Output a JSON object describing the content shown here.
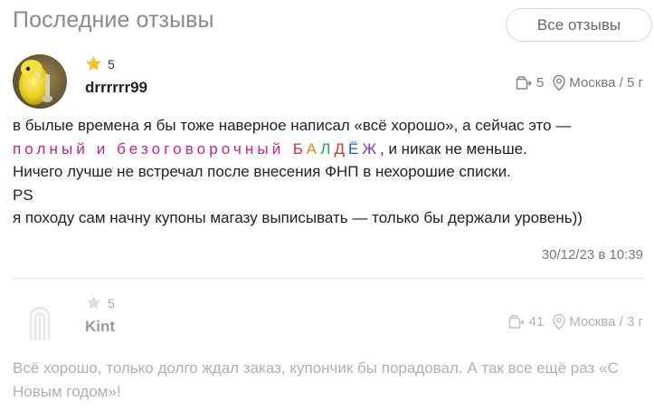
{
  "header": {
    "title": "Последние отзывы",
    "all_reviews_label": "Все отзывы"
  },
  "reviews": [
    {
      "rating": "5",
      "username": "drrrrrr99",
      "order_count": "5",
      "location": "Москва / 5 г",
      "text": {
        "line1": "в былые времена я бы тоже наверное написал «всё хорошо», а сейчас это —",
        "line2_colored": "полный и безоговорочный",
        "line2_baldezh": [
          "Б",
          "А",
          "Л",
          "Д",
          "Ё",
          "Ж"
        ],
        "line2_rest": ", и никак не меньше.",
        "line3": "Ничего  лучше не встречал после внесения ФНП в нехорошие списки.",
        "line4": "PS",
        "line5": "я походу сам начну купоны магазу выписывать — только бы держали уровень))"
      },
      "date": "30/12/23 в 10:39"
    },
    {
      "rating": "5",
      "username": "Kint",
      "order_count": "41",
      "location": "Москва / 3 г",
      "text": {
        "line1": "Всё хорошо, только долго ждал заказ, купончик бы порадовал. А так все ещё раз «С Новым годом»!"
      }
    }
  ],
  "colors": {
    "pink": "#c41f93",
    "baldezh": [
      "#e0312c",
      "#f08a00",
      "#1aa34a",
      "#e0312c",
      "#1e5bd8",
      "#8b2fd0"
    ],
    "star_active": "#f6c324",
    "star_inactive": "#d8d8d8"
  },
  "icons": {
    "order": "cart-box-icon",
    "location": "location-pin-icon",
    "rating": "star-icon",
    "placeholder_avatar": "brand-logo-icon"
  }
}
